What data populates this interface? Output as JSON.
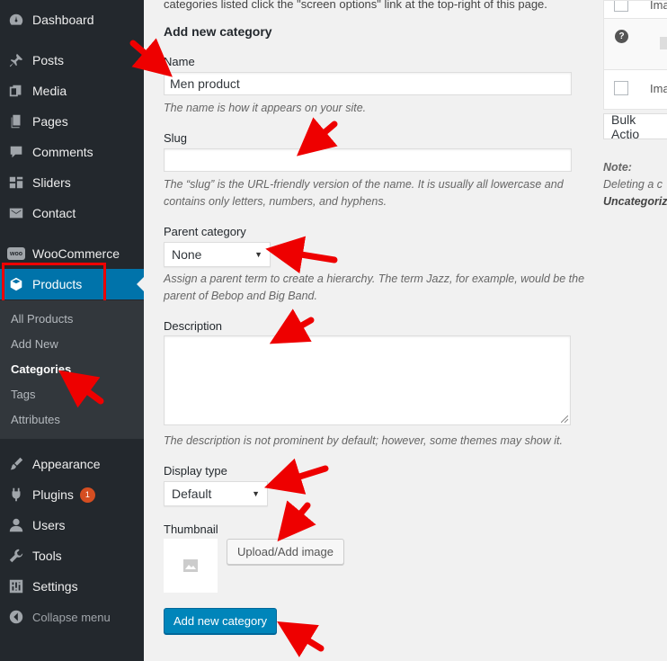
{
  "sidebar": {
    "items": [
      {
        "label": "Dashboard",
        "icon": "dashboard-icon"
      },
      {
        "label": "Posts",
        "icon": "pin-icon"
      },
      {
        "label": "Media",
        "icon": "media-icon"
      },
      {
        "label": "Pages",
        "icon": "pages-icon"
      },
      {
        "label": "Comments",
        "icon": "comments-icon"
      },
      {
        "label": "Sliders",
        "icon": "sliders-icon"
      },
      {
        "label": "Contact",
        "icon": "mail-icon"
      },
      {
        "label": "WooCommerce",
        "icon": "woocommerce-icon"
      },
      {
        "label": "Products",
        "icon": "cube-icon"
      },
      {
        "label": "Appearance",
        "icon": "brush-icon"
      },
      {
        "label": "Plugins",
        "icon": "plug-icon",
        "badge": "1"
      },
      {
        "label": "Users",
        "icon": "user-icon"
      },
      {
        "label": "Tools",
        "icon": "wrench-icon"
      },
      {
        "label": "Settings",
        "icon": "settings-icon"
      },
      {
        "label": "Collapse menu",
        "icon": "collapse-icon"
      }
    ],
    "submenu": [
      "All Products",
      "Add New",
      "Categories",
      "Tags",
      "Attributes"
    ],
    "woo_logo_text": "woo"
  },
  "form": {
    "intro": "categories listed click the \"screen options\" link at the top-right of this page.",
    "heading": "Add new category",
    "name_label": "Name",
    "name_value": "Men product",
    "name_desc": "The name is how it appears on your site.",
    "slug_label": "Slug",
    "slug_value": "",
    "slug_desc": "The “slug” is the URL-friendly version of the name. It is usually all lowercase and contains only letters, numbers, and hyphens.",
    "parent_label": "Parent category",
    "parent_value": "None",
    "parent_desc": "Assign a parent term to create a hierarchy. The term Jazz, for example, would be the parent of Bebop and Big Band.",
    "description_label": "Description",
    "description_desc": "The description is not prominent by default; however, some themes may show it.",
    "display_label": "Display type",
    "display_value": "Default",
    "thumbnail_label": "Thumbnail",
    "upload_button": "Upload/Add image",
    "submit_button": "Add new category"
  },
  "right_panel": {
    "row1": "Ima",
    "row3": "Ima",
    "bulk_actions": "Bulk Actio",
    "note_label": "Note:",
    "note_line1": "Deleting a c",
    "note_line2": "Uncategoriz"
  },
  "colors": {
    "sidebar_bg": "#23282d",
    "active_bg": "#0073aa",
    "primary_button": "#0085ba",
    "annotation_arrow": "#e00000"
  }
}
